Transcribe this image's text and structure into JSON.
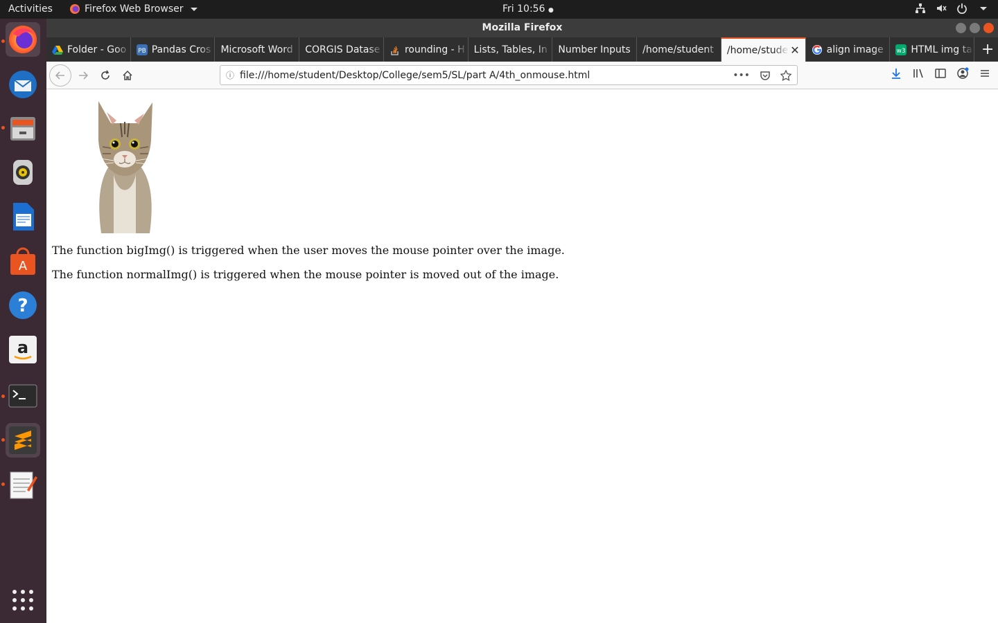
{
  "topbar": {
    "activities": "Activities",
    "app_name": "Firefox Web Browser",
    "clock": "Fri 10:56"
  },
  "window": {
    "title": "Mozilla Firefox"
  },
  "tabs": [
    {
      "label": "Folder - Goo",
      "favicon_color": "#1a73e8"
    },
    {
      "label": "Pandas Cros",
      "favicon_color": "#3b6fb6"
    },
    {
      "label": "Microsoft Word",
      "favicon_color": ""
    },
    {
      "label": "CORGIS Datase",
      "favicon_color": ""
    },
    {
      "label": "rounding - H",
      "favicon_color": "#f48024"
    },
    {
      "label": "Lists, Tables, In",
      "favicon_color": ""
    },
    {
      "label": "Number Inputs",
      "favicon_color": ""
    },
    {
      "label": "/home/student",
      "favicon_color": ""
    },
    {
      "label": "/home/stude",
      "favicon_color": "",
      "selected": true
    },
    {
      "label": "align image",
      "favicon_color": "#4285f4"
    },
    {
      "label": "HTML img ta",
      "favicon_color": "#04aa6d"
    }
  ],
  "navbar": {
    "url": "file:///home/student/Desktop/College/sem5/SL/part A/4th_onmouse.html"
  },
  "page": {
    "para1": "The function bigImg() is triggered when the user moves the mouse pointer over the image.",
    "para2": "The function normalImg() is triggered when the mouse pointer is moved out of the image."
  },
  "colors": {
    "accent": "#e95420",
    "dock_bg": "#3b2a34",
    "topbar_bg": "#1d1d1d"
  }
}
